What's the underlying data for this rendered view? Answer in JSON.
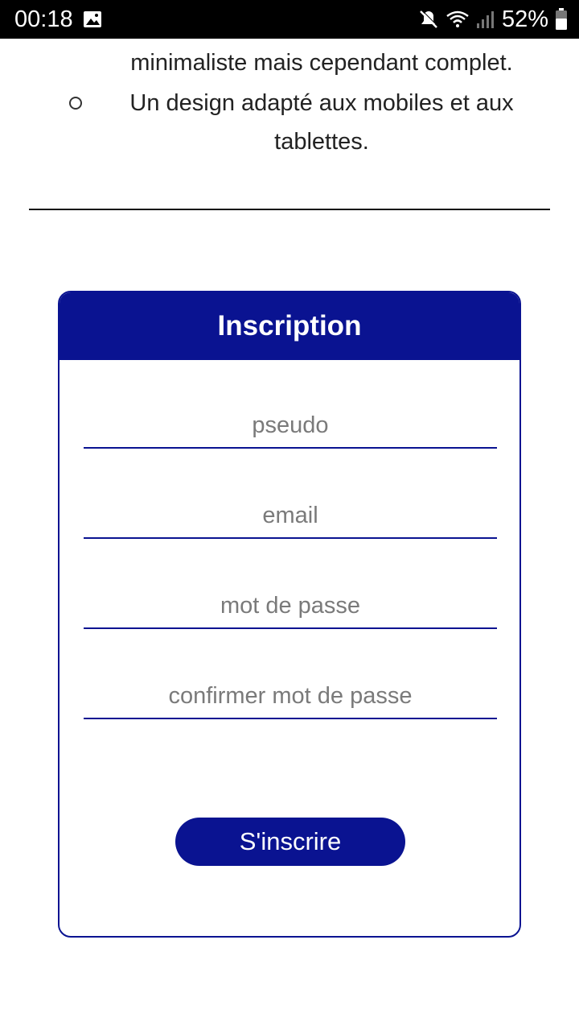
{
  "status_bar": {
    "time": "00:18",
    "battery": "52%",
    "icons": [
      "image-icon",
      "mute-icon",
      "wifi-icon",
      "signal-icon",
      "battery-icon"
    ]
  },
  "page": {
    "line_partial": "minimaliste mais cependant complet.",
    "bullet_line1": "Un design adapté aux mobiles et aux",
    "bullet_line2": "tablettes."
  },
  "form": {
    "title": "Inscription",
    "fields": [
      {
        "placeholder": "pseudo",
        "type": "text"
      },
      {
        "placeholder": "email",
        "type": "email"
      },
      {
        "placeholder": "mot de passe",
        "type": "password"
      },
      {
        "placeholder": "confirmer mot de passe",
        "type": "password"
      }
    ],
    "submit_label": "S'inscrire"
  },
  "colors": {
    "accent": "#0a1391",
    "status_bar_bg": "#000000",
    "background": "#ffffff"
  }
}
